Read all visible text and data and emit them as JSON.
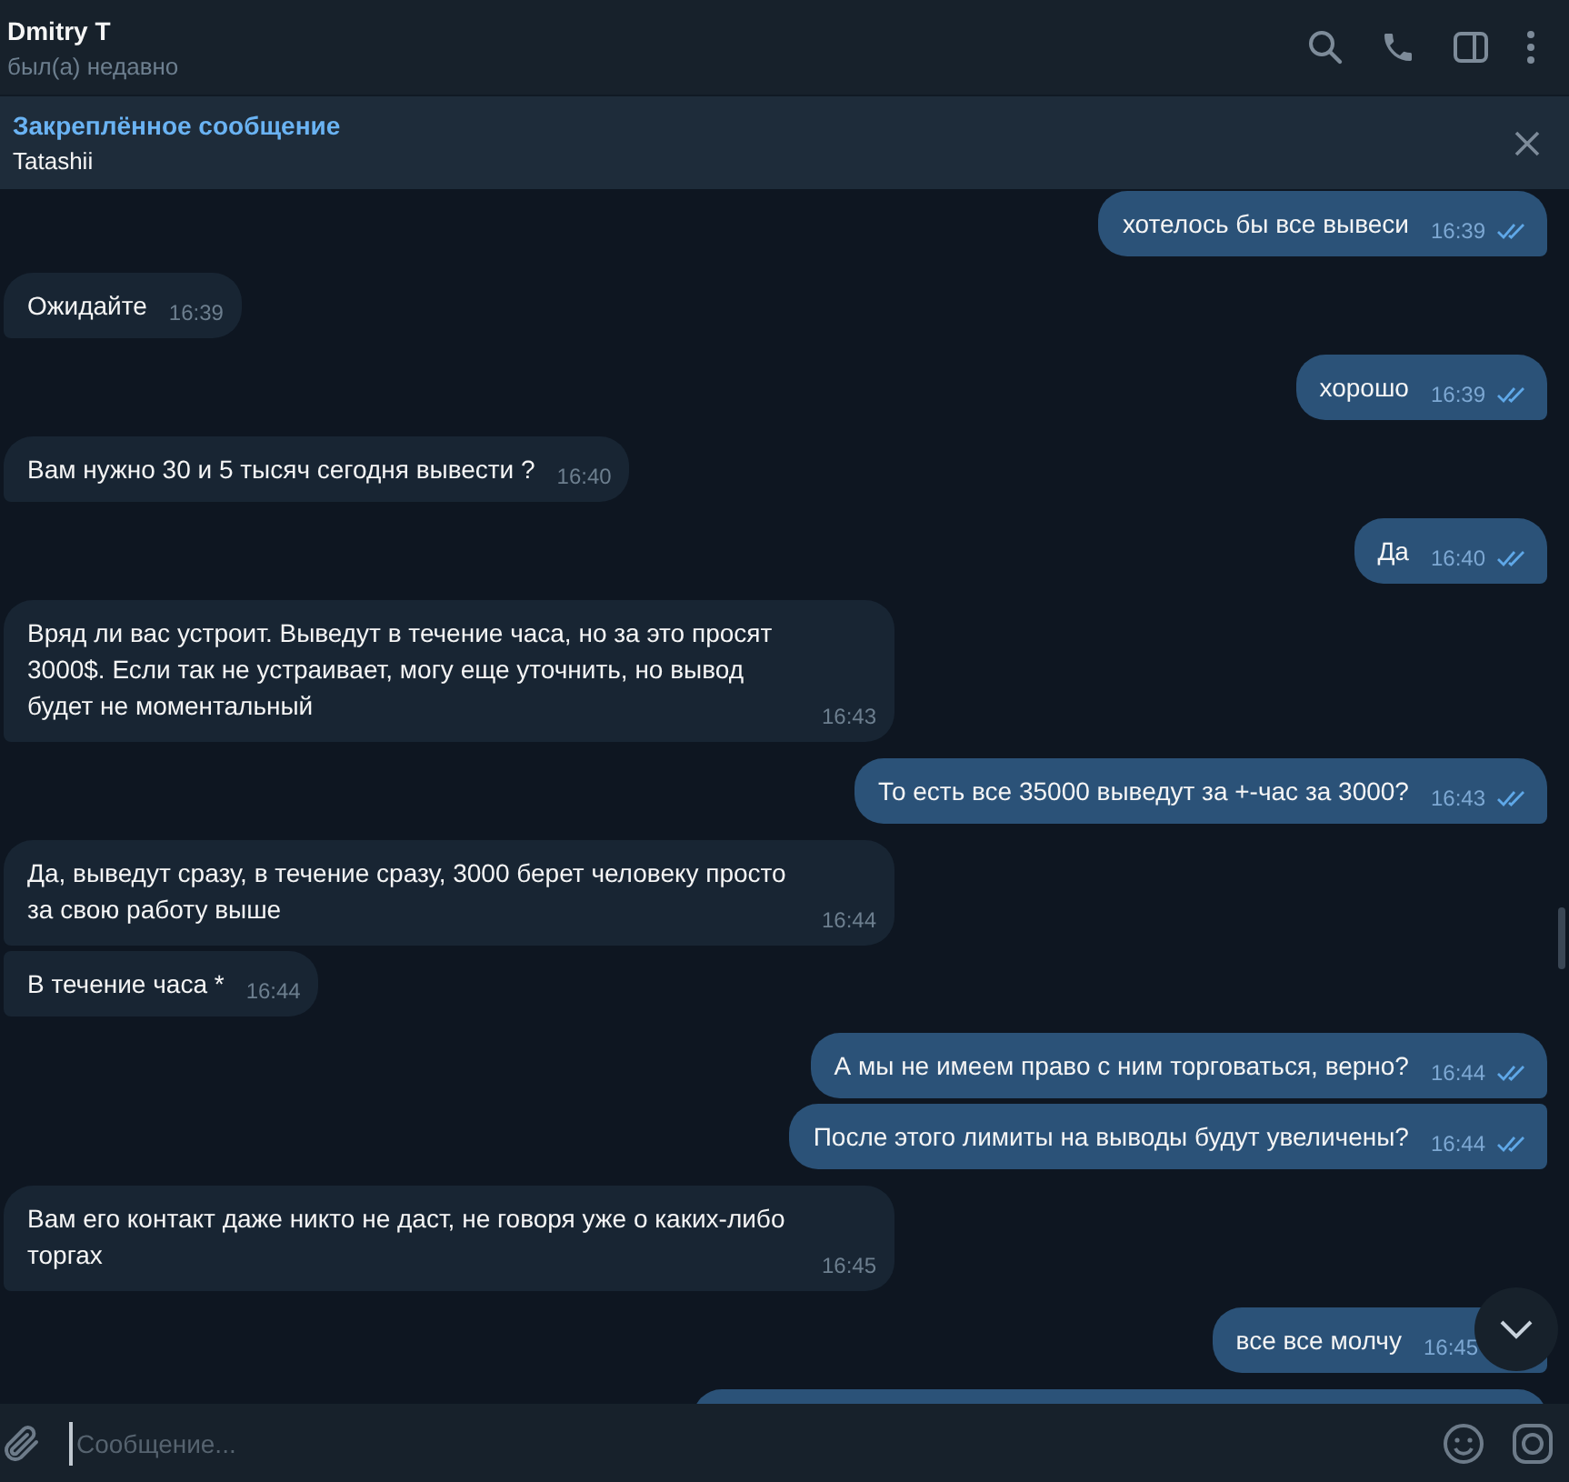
{
  "header": {
    "name": "Dmitry T",
    "status": "был(а) недавно"
  },
  "pinned": {
    "title": "Закреплённое сообщение",
    "text": "Tatashii"
  },
  "messages": [
    {
      "kind": "out",
      "text": "хотелось бы все вывеси",
      "time": "16:39",
      "read": true
    },
    {
      "kind": "in",
      "text": "Ожидайте",
      "time": "16:39"
    },
    {
      "kind": "out",
      "text": "хорошо",
      "time": "16:39",
      "read": true
    },
    {
      "kind": "in",
      "text": "Вам нужно 30 и 5 тысяч сегодня вывести ?",
      "time": "16:40"
    },
    {
      "kind": "out",
      "text": "Да",
      "time": "16:40",
      "read": true
    },
    {
      "kind": "in",
      "text": "Вряд ли вас устроит. Выведут в течение часа, но за это просят 3000$. Если так не устраивает, могу еще уточнить, но вывод будет не моментальный",
      "time": "16:43"
    },
    {
      "kind": "out",
      "text": "То есть все 35000 выведут за +-час за 3000?",
      "time": "16:43",
      "read": true
    },
    {
      "kind": "in",
      "text": "Да, выведут сразу, в течение сразу, 3000 берет человеку просто за свою работу выше",
      "time": "16:44"
    },
    {
      "kind": "in",
      "text": "В течение часа *",
      "time": "16:44",
      "follow": true
    },
    {
      "kind": "out",
      "text": "А мы не имеем право с ним торговаться, верно?",
      "time": "16:44",
      "read": true
    },
    {
      "kind": "out",
      "text": "После этого лимиты на выводы будут увеличены?",
      "time": "16:44",
      "read": true,
      "follow": true
    },
    {
      "kind": "in",
      "text": "Вам его контакт даже никто не даст, не говоря уже о каких-либо торгах",
      "time": "16:45"
    },
    {
      "kind": "out",
      "text": "все все молчу",
      "time": "16:45"
    },
    {
      "kind": "cut"
    }
  ],
  "composer": {
    "placeholder": "Сообщение..."
  }
}
